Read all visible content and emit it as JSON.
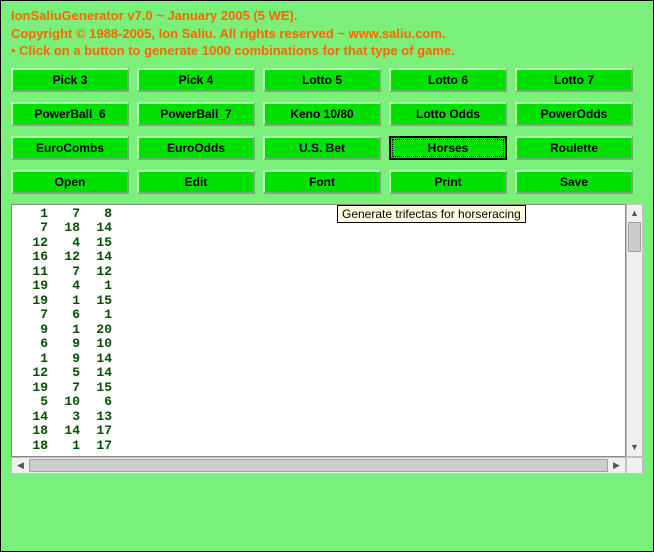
{
  "header": {
    "line1": "IonSaliuGenerator v7.0 ~ January 2005 (5 WE).",
    "line2": "Copyright © 1988-2005, Ion Saliu. All rights reserved ~ www.saliu.com.",
    "line3": "• Click on a button to generate 1000 combinations for that type of game."
  },
  "buttons": {
    "r0": [
      "Pick 3",
      "Pick 4",
      "Lotto 5",
      "Lotto 6",
      "Lotto 7"
    ],
    "r1": [
      "PowerBall_6",
      "PowerBall_7",
      "Keno 10/80",
      "Lotto Odds",
      "PowerOdds"
    ],
    "r2": [
      "EuroCombs",
      "EuroOdds",
      "U.S. Bet",
      "Horses",
      "Roulette"
    ],
    "r3": [
      "Open",
      "Edit",
      "Font",
      "Print",
      "Save"
    ]
  },
  "focused_button": "Horses",
  "tooltip": "Generate trifectas for horseracing",
  "output_rows": [
    [
      1,
      7,
      8
    ],
    [
      7,
      18,
      14
    ],
    [
      12,
      4,
      15
    ],
    [
      16,
      12,
      14
    ],
    [
      11,
      7,
      12
    ],
    [
      19,
      4,
      1
    ],
    [
      19,
      1,
      15
    ],
    [
      7,
      6,
      1
    ],
    [
      9,
      1,
      20
    ],
    [
      6,
      9,
      10
    ],
    [
      1,
      9,
      14
    ],
    [
      12,
      5,
      14
    ],
    [
      19,
      7,
      15
    ],
    [
      5,
      10,
      6
    ],
    [
      14,
      3,
      13
    ],
    [
      18,
      14,
      17
    ],
    [
      18,
      1,
      17
    ]
  ]
}
